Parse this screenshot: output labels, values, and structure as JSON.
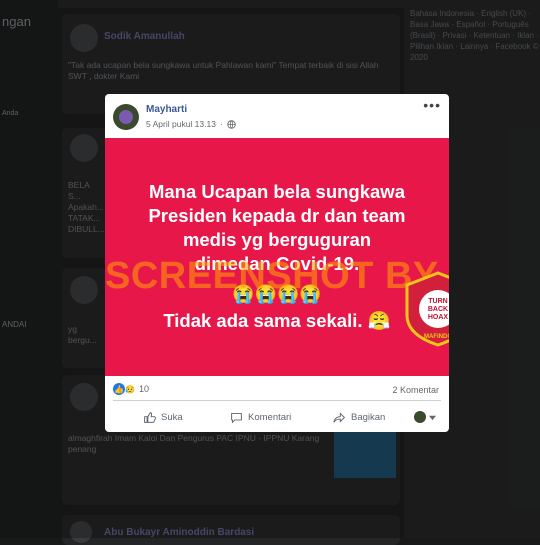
{
  "background": {
    "left_nav": [
      "ngan",
      "Anda",
      "ANDAI"
    ],
    "right_links": "Bahasa Indonesia · English (UK) · Basa Jawa · Español · Português (Brasil) · Privasi · Ketentuan · Iklan · Pilihan Iklan · Lainnya · Facebook © 2020",
    "posts": [
      {
        "author": "Sodik Amanullah",
        "text": "\"Tak ada ucapan bela sungkawa untuk Pahlawan kami\" Tempat terbaik di sisi Allah SWT , dokter Kami"
      },
      {
        "author": "",
        "text": "BELA S... Apakah... TATAK... DIBULL..."
      },
      {
        "author": "",
        "text": "yg bergu..."
      },
      {
        "author": "",
        "text": "almaghfirah Imam Kaloi Dan Pengurus PAC IPNU - IPPNU Karang penang"
      },
      {
        "author": "Abu Bukayr Aminoddin Bardasi",
        "text": ""
      }
    ]
  },
  "post": {
    "author": "Mayharti",
    "date": "5 April pukul 13.13",
    "image": {
      "lines": [
        "Mana Ucapan bela sungkawa",
        "Presiden kepada dr dan team",
        "medis yg berguguran",
        "dimedan Covid-19."
      ],
      "emojis": "😭😭😭😭",
      "last_line": "Tidak ada sama sekali. 😤",
      "watermark": "SCREENSHOT BY",
      "seal_top": "MASYARAKAT ANTI FITNAH INDONESIA",
      "seal_center": [
        "TURN",
        "BACK",
        "HOAX"
      ],
      "seal_bottom": "MAFINDO"
    },
    "reactions_count": "10",
    "comments_count": "2 Komentar",
    "actions": {
      "like": "Suka",
      "comment": "Komentari",
      "share": "Bagikan"
    }
  },
  "colors": {
    "image_bg": "#e8174a",
    "author": "#385898",
    "seal_red": "#d21f3c",
    "seal_yellow": "#f0c419"
  }
}
